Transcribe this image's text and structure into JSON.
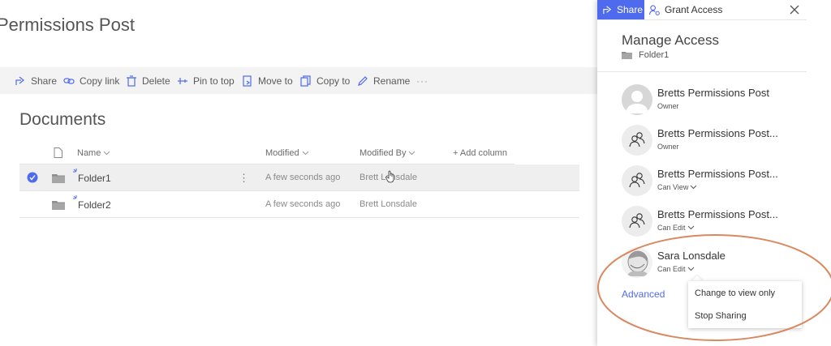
{
  "site": {
    "title": "Permissions Post"
  },
  "commands": [
    {
      "label": "Share",
      "icon": "share-icon"
    },
    {
      "label": "Copy link",
      "icon": "link-icon"
    },
    {
      "label": "Delete",
      "icon": "trash-icon"
    },
    {
      "label": "Pin to top",
      "icon": "pin-icon"
    },
    {
      "label": "Move to",
      "icon": "move-icon"
    },
    {
      "label": "Copy to",
      "icon": "copy-icon"
    },
    {
      "label": "Rename",
      "icon": "pencil-icon"
    },
    {
      "label": "···",
      "icon": "more-icon"
    }
  ],
  "library": {
    "title": "Documents",
    "columns": {
      "name": "Name",
      "modified": "Modified",
      "modified_by": "Modified By",
      "add": "+ Add column"
    },
    "rows": [
      {
        "name": "Folder1",
        "modified": "A few seconds ago",
        "modified_by": "Brett Lonsdale",
        "selected": true
      },
      {
        "name": "Folder2",
        "modified": "A few seconds ago",
        "modified_by": "Brett Lonsdale",
        "selected": false
      }
    ]
  },
  "panel": {
    "tab_share": "Share",
    "tab_grant": "Grant Access",
    "title": "Manage Access",
    "item": "Folder1",
    "entries": [
      {
        "name": "Bretts Permissions Post",
        "role": "Owner",
        "avatar": "person-placeholder-icon",
        "dropdown": false
      },
      {
        "name": "Bretts Permissions Post...",
        "role": "Owner",
        "avatar": "group-icon",
        "dropdown": false
      },
      {
        "name": "Bretts Permissions Post...",
        "role": "Can View",
        "avatar": "group-icon",
        "dropdown": true
      },
      {
        "name": "Bretts Permissions Post...",
        "role": "Can Edit",
        "avatar": "group-icon",
        "dropdown": true
      },
      {
        "name": "Sara Lonsdale",
        "role": "Can Edit",
        "avatar": "user-photo",
        "dropdown": true
      }
    ],
    "advanced": "Advanced",
    "menu": [
      "Change to view only",
      "Stop Sharing"
    ]
  },
  "colors": {
    "accent": "#4f6bed",
    "annotation": "#d98860"
  }
}
